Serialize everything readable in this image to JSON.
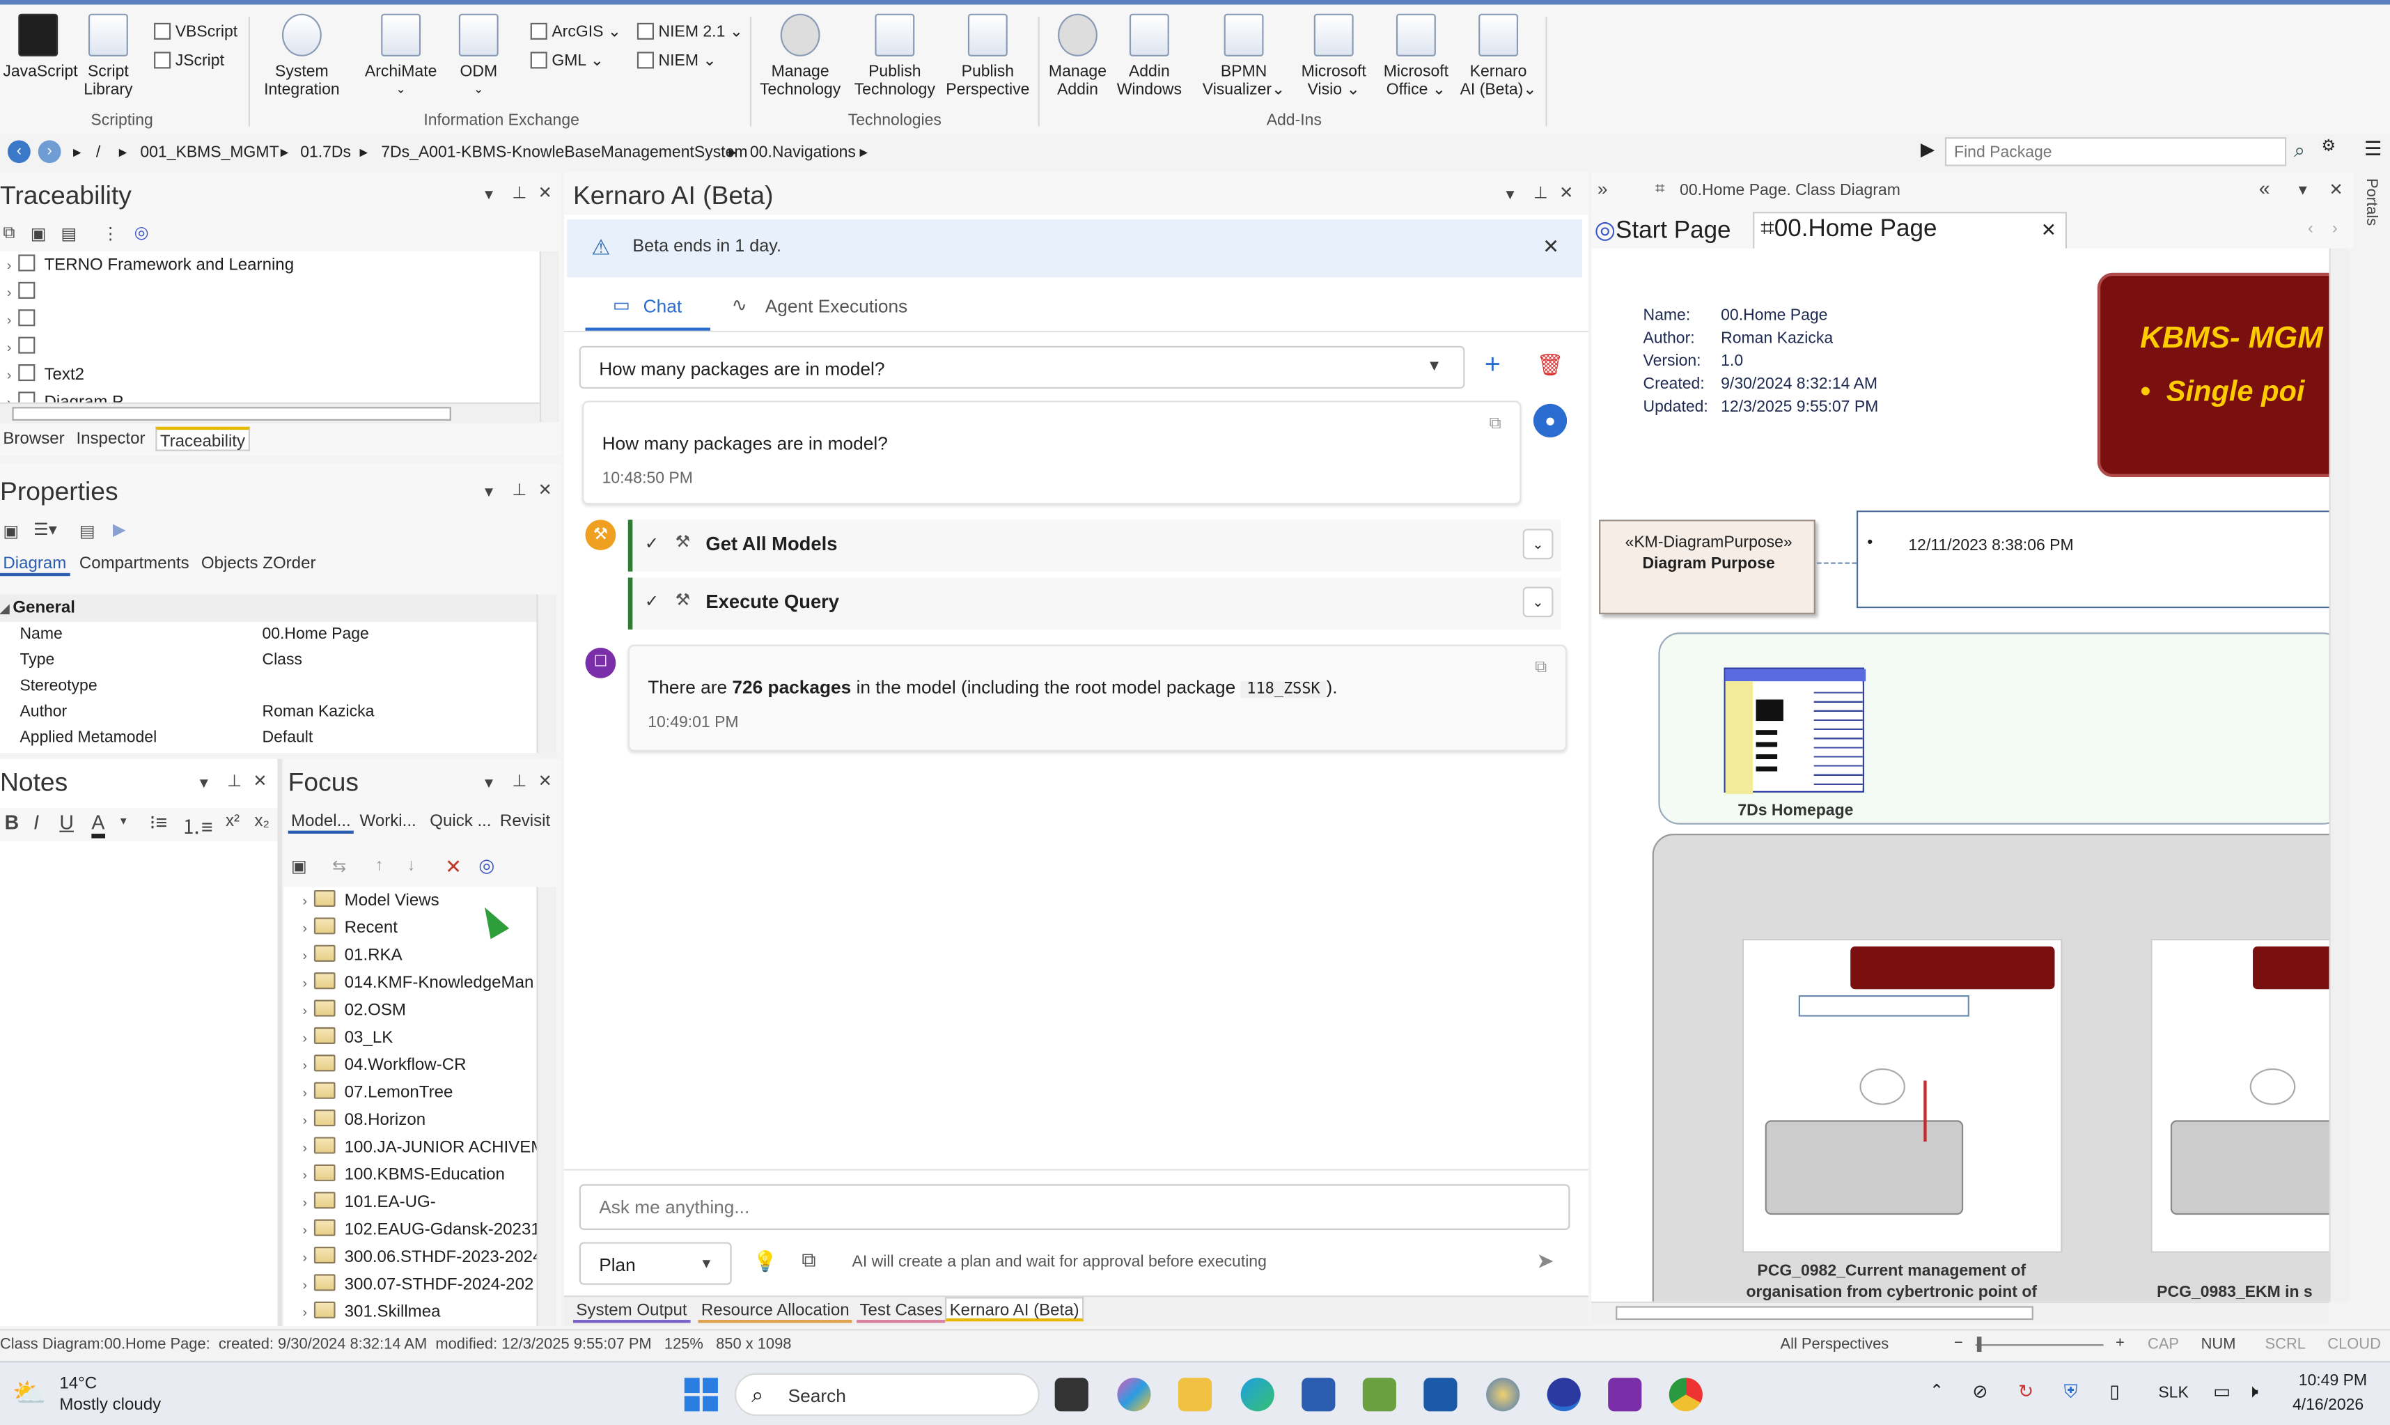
{
  "ribbon": {
    "scripting": {
      "javascript": "JavaScript",
      "script_library_1": "Script",
      "script_library_2": "Library",
      "vbscript": "VBScript",
      "jscript": "JScript",
      "group": "Scripting"
    },
    "info_exchange": {
      "system_integration_1": "System",
      "system_integration_2": "Integration",
      "archimate": "ArchiMate",
      "odm": "ODM",
      "arcgis": "ArcGIS",
      "gml": "GML",
      "niem21": "NIEM 2.1",
      "niem": "NIEM",
      "group": "Information Exchange"
    },
    "technologies": {
      "manage_tech_1": "Manage",
      "manage_tech_2": "Technology",
      "publish_tech_1": "Publish",
      "publish_tech_2": "Technology",
      "publish_persp_1": "Publish",
      "publish_persp_2": "Perspective",
      "group": "Technologies"
    },
    "addins": {
      "manage_addin_1": "Manage",
      "manage_addin_2": "Addin",
      "addin_windows_1": "Addin",
      "addin_windows_2": "Windows",
      "bpmn_1": "BPMN",
      "bpmn_2": "Visualizer",
      "visio_1": "Microsoft",
      "visio_2": "Visio",
      "office_1": "Microsoft",
      "office_2": "Office",
      "kernaro_1": "Kernaro",
      "kernaro_2": "AI (Beta)",
      "group": "Add-Ins"
    }
  },
  "address": {
    "crumbs": [
      "/",
      "001_KBMS_MGMT",
      "01.7Ds",
      "7Ds_A001-KBMS-KnowleBaseManagementSystem",
      "00.Navigations"
    ],
    "find_placeholder": "Find Package"
  },
  "traceability": {
    "title": "Traceability",
    "items": [
      "TERNO Framework and Learning",
      "",
      "",
      "",
      "Text2",
      "Diagram P..."
    ],
    "tabs": [
      "Browser",
      "Inspector",
      "Traceability"
    ]
  },
  "properties": {
    "title": "Properties",
    "tabs": [
      "Diagram",
      "Compartments",
      "Objects ZOrder"
    ],
    "section": "General",
    "rows": [
      {
        "key": "Name",
        "value": "00.Home Page"
      },
      {
        "key": "Type",
        "value": "Class"
      },
      {
        "key": "Stereotype",
        "value": ""
      },
      {
        "key": "Author",
        "value": "Roman Kazicka"
      },
      {
        "key": "Applied Metamodel",
        "value": "Default"
      }
    ]
  },
  "notes": {
    "title": "Notes"
  },
  "focus": {
    "title": "Focus",
    "tabs": [
      "Model...",
      "Worki...",
      "Quick ...",
      "Revisit"
    ],
    "items": [
      "Model Views",
      "Recent",
      "01.RKA",
      "014.KMF-KnowledgeMan",
      "02.OSM",
      "03_LK",
      "04.Workflow-CR",
      "07.LemonTree",
      "08.Horizon",
      "100.JA-JUNIOR ACHIVEM",
      "100.KBMS-Education",
      "101.EA-UG-",
      "102.EAUG-Gdansk-20231",
      "300.06.STHDF-2023-2024",
      "300.07-STHDF-2024-202",
      "301.Skillmea"
    ]
  },
  "kernaro": {
    "title": "Kernaro AI (Beta)",
    "beta_notice": "Beta ends in 1 day.",
    "tabs": {
      "chat": "Chat",
      "agent": "Agent Executions"
    },
    "conversation_select": "How many packages are in model?",
    "user_message": {
      "text": "How many packages are in model?",
      "time": "10:48:50 PM"
    },
    "tools": [
      "Get All Models",
      "Execute Query"
    ],
    "reply": {
      "pre": "There are ",
      "bold": "726 packages",
      "mid": " in the model (including the root model package ",
      "code": "118_ZSSK",
      "post": ").",
      "time": "10:49:01 PM"
    },
    "input_placeholder": "Ask me anything...",
    "mode": "Plan",
    "mode_hint": "AI will create a plan and wait for approval before executing",
    "bottom_tabs": [
      "System Output",
      "Resource Allocation",
      "Test Cases",
      "Kernaro AI (Beta)"
    ]
  },
  "diagram": {
    "header": "00.Home Page.  Class Diagram",
    "tabs": [
      "Start Page",
      "00.Home Page"
    ],
    "meta": [
      {
        "k": "Name:",
        "v": "00.Home Page"
      },
      {
        "k": "Author:",
        "v": "Roman Kazicka"
      },
      {
        "k": "Version:",
        "v": "1.0"
      },
      {
        "k": "Created:",
        "v": "9/30/2024 8:32:14 AM"
      },
      {
        "k": "Updated:",
        "v": "12/3/2025 9:55:07 PM"
      }
    ],
    "banner_title": "KBMS- MGM",
    "banner_bullet": "Single poi",
    "purpose_stereo": "«KM-DiagramPurpose»",
    "purpose_name": "Diagram Purpose",
    "purpose_note": "12/11/2023 8:38:06 PM",
    "homepage_caption": "7Ds Homepage",
    "pcg1_line1": "PCG_0982_Current management of",
    "pcg1_line2": "organisation from cybertronic point of",
    "pcg2_line1": "PCG_0983_EKM in s"
  },
  "portals_label": "Portals",
  "status": {
    "left": "Class Diagram:00.Home Page:  created: 9/30/2024 8:32:14 AM  modified: 12/3/2025 9:55:07 PM   125%   850 x 1098",
    "perspectives": "All Perspectives",
    "caps": [
      "CAP",
      "NUM",
      "SCRL",
      "CLOUD"
    ]
  },
  "taskbar": {
    "weather_temp": "14°C",
    "weather_desc": "Mostly cloudy",
    "search": "Search",
    "lang": "SLK",
    "time": "10:49 PM",
    "date": "4/16/2026"
  }
}
